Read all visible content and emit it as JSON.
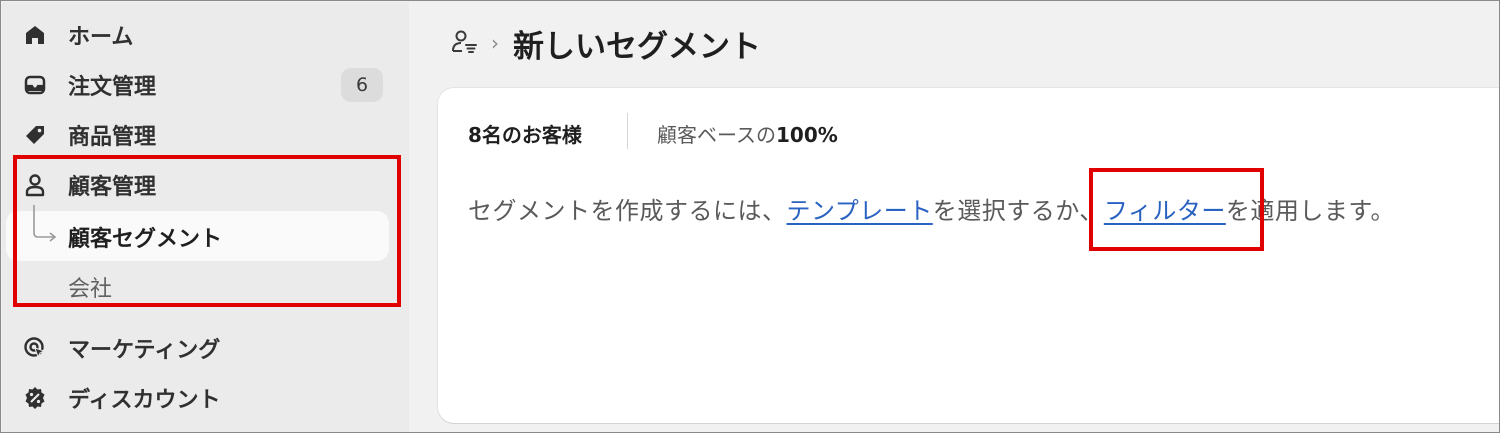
{
  "sidebar": {
    "items": [
      {
        "label": "ホーム",
        "icon": "home-icon"
      },
      {
        "label": "注文管理",
        "icon": "inbox-icon",
        "badge": "6"
      },
      {
        "label": "商品管理",
        "icon": "tag-icon"
      },
      {
        "label": "顧客管理",
        "icon": "person-icon"
      },
      {
        "label": "マーケティング",
        "icon": "target-icon"
      },
      {
        "label": "ディスカウント",
        "icon": "discount-icon"
      }
    ],
    "subitems": [
      {
        "label": "顧客セグメント",
        "active": true
      },
      {
        "label": "会社",
        "active": false
      }
    ]
  },
  "header": {
    "breadcrumb_icon": "customer-segment-icon",
    "title": "新しいセグメント"
  },
  "card": {
    "customer_count": "8名のお客様",
    "base_prefix": "顧客ベースの",
    "base_percent": "100%",
    "instruction_pre": "セグメントを作成するには、",
    "link_template": "テンプレート",
    "instruction_mid": "を選択するか、",
    "link_filter": "フィルター",
    "instruction_post": "を適用します。"
  },
  "colors": {
    "highlight": "#e00000",
    "link": "#2a62c2",
    "sidebar_bg": "#ebebeb"
  }
}
